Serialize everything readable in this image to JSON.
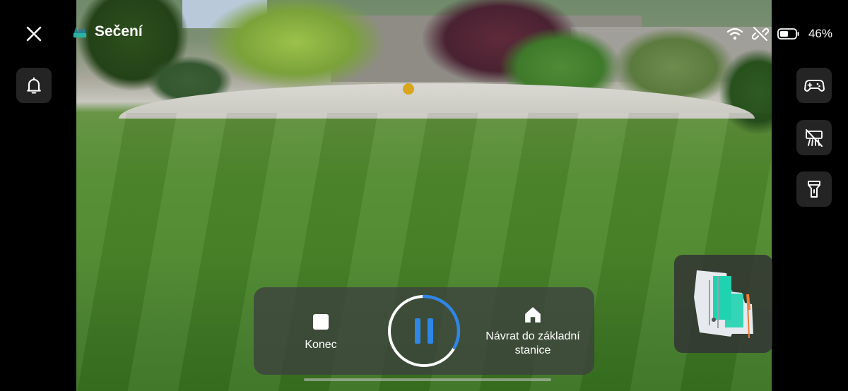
{
  "header": {
    "title": "Sečení",
    "close_icon": "close-icon",
    "app_icon": "lawn-mower-app-icon"
  },
  "status_bar": {
    "wifi_icon": "wifi-icon",
    "link_icon": "link-off-icon",
    "battery_icon": "battery-icon",
    "battery_percent": "46%"
  },
  "left_controls": {
    "bell_icon": "bell-icon"
  },
  "right_controls": [
    {
      "icon": "gamepad-icon"
    },
    {
      "icon": "grass-off-icon"
    },
    {
      "icon": "flashlight-icon"
    }
  ],
  "bottom_controls": {
    "end_label": "Konec",
    "home_label": "Návrat do základní stanice",
    "pause_progress": 0.33
  },
  "colors": {
    "accent": "#2e86e6",
    "map_area": "#20d3b0",
    "map_base": "#f07d3a"
  }
}
